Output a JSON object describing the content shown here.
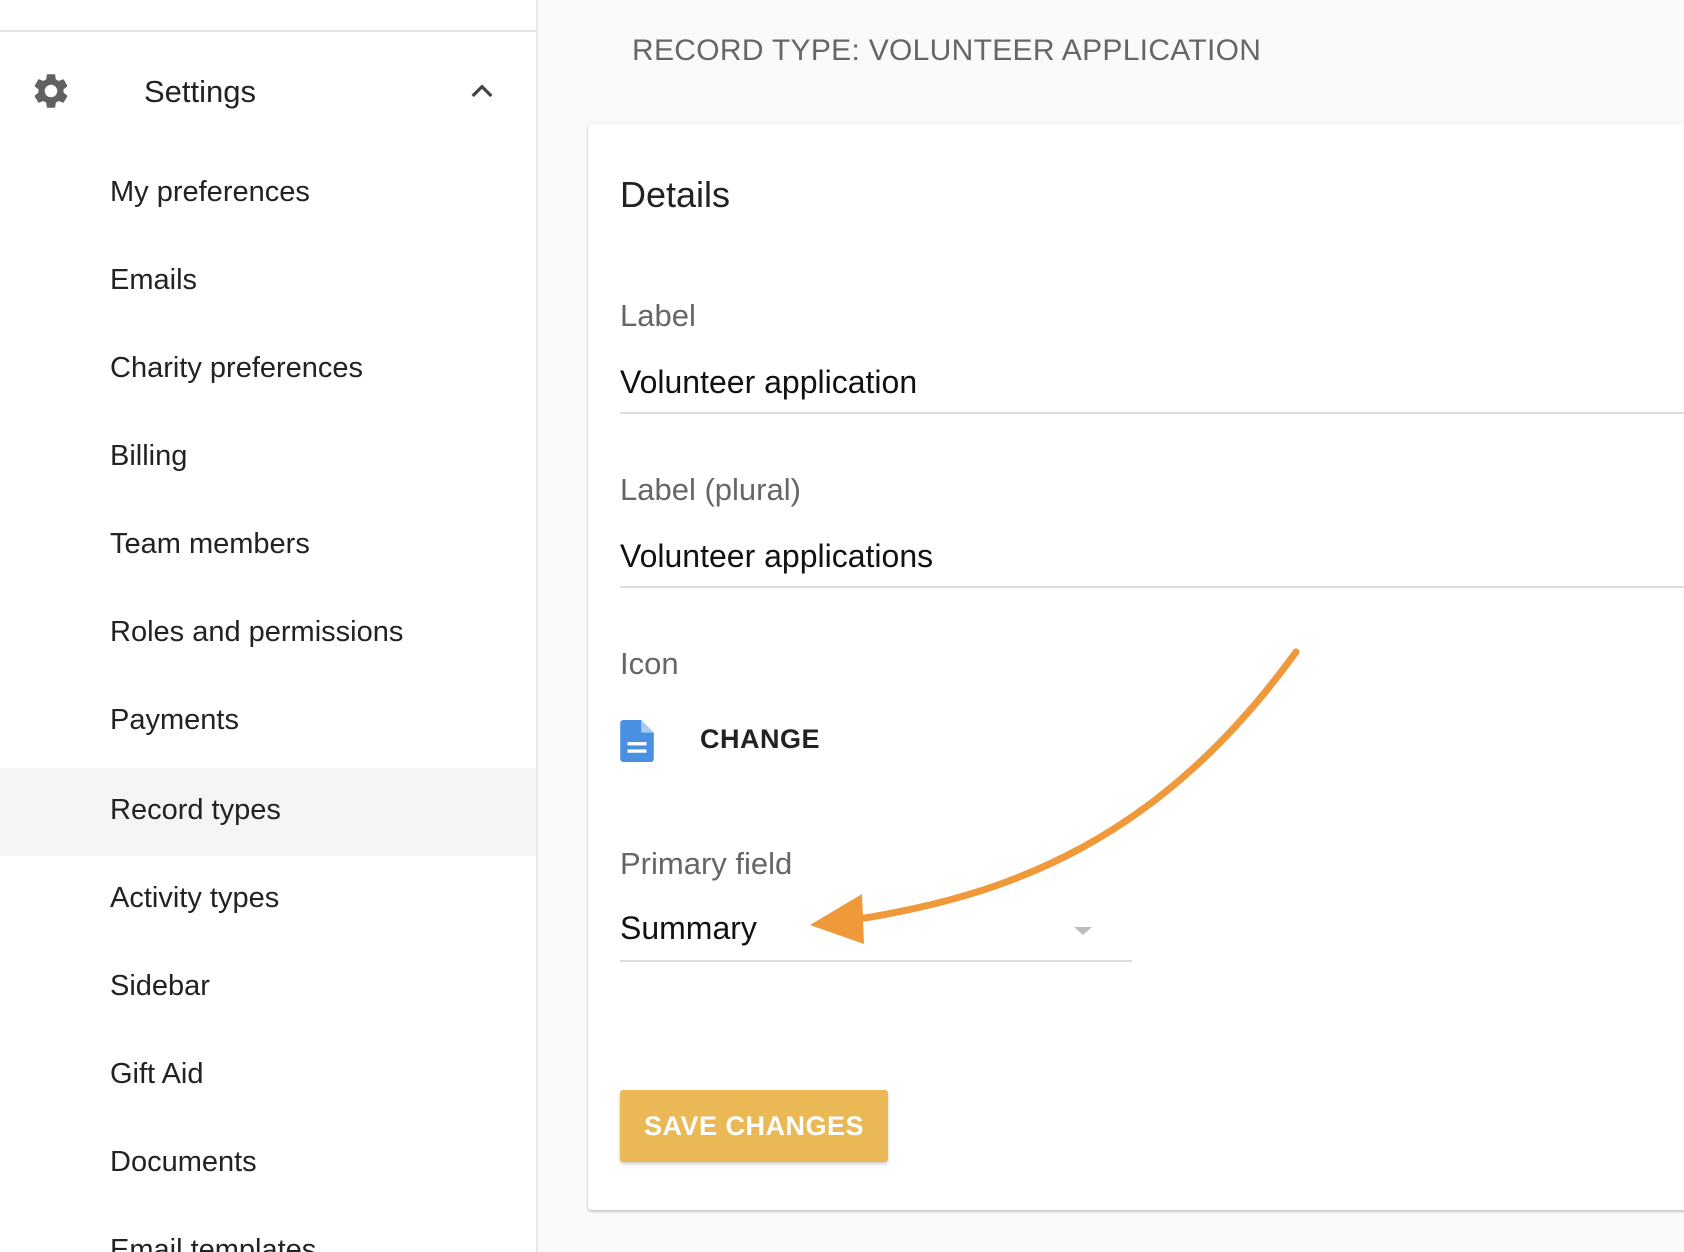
{
  "sidebar": {
    "header": {
      "label": "Settings",
      "icon": "gear-icon",
      "expand_icon": "chevron-up-icon"
    },
    "items": [
      {
        "label": "My preferences"
      },
      {
        "label": "Emails"
      },
      {
        "label": "Charity preferences"
      },
      {
        "label": "Billing"
      },
      {
        "label": "Team members"
      },
      {
        "label": "Roles and permissions"
      },
      {
        "label": "Payments"
      },
      {
        "label": "Record types",
        "active": true
      },
      {
        "label": "Activity types"
      },
      {
        "label": "Sidebar"
      },
      {
        "label": "Gift Aid"
      },
      {
        "label": "Documents"
      },
      {
        "label": "Email templates"
      }
    ]
  },
  "main": {
    "title": "RECORD TYPE: VOLUNTEER APPLICATION",
    "card": {
      "title": "Details",
      "label_field": {
        "label": "Label",
        "value": "Volunteer application"
      },
      "label_plural_field": {
        "label": "Label (plural)",
        "value": "Volunteer applications"
      },
      "icon_field": {
        "label": "Icon",
        "icon": "document-icon",
        "change_label": "CHANGE"
      },
      "primary_field": {
        "label": "Primary field",
        "value": "Summary"
      },
      "save_label": "SAVE CHANGES"
    }
  },
  "colors": {
    "accent_button": "#eab955",
    "annotation_arrow": "#f0993a",
    "doc_icon": "#4a90e2"
  }
}
